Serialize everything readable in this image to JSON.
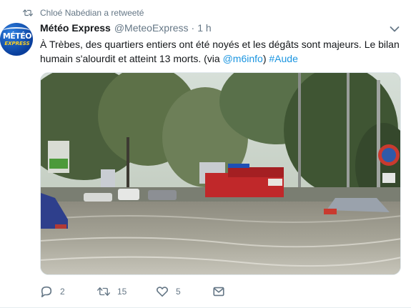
{
  "retweet_context": {
    "text": "Chloé Nabédian a retweeté",
    "icon": "retweet-icon"
  },
  "tweet": {
    "author_name": "Météo Express",
    "handle": "@MeteoExpress",
    "separator": "·",
    "time": "1 h",
    "avatar": {
      "line1": "MÉTÉO",
      "line2": "EXPRESS"
    },
    "text_before_mention": "À Trèbes, des quartiers entiers ont été noyés et les dégâts sont majeurs. Le bilan humain s'alourdit et atteint 13 morts. (via ",
    "mention": "@m6info",
    "text_after_mention": ") ",
    "hashtag": "#Aude"
  },
  "actions": {
    "reply_count": "2",
    "retweet_count": "15",
    "like_count": "5"
  },
  "colors": {
    "link": "#1b95e0",
    "secondary_text": "#657786",
    "primary_text": "#14171a"
  }
}
